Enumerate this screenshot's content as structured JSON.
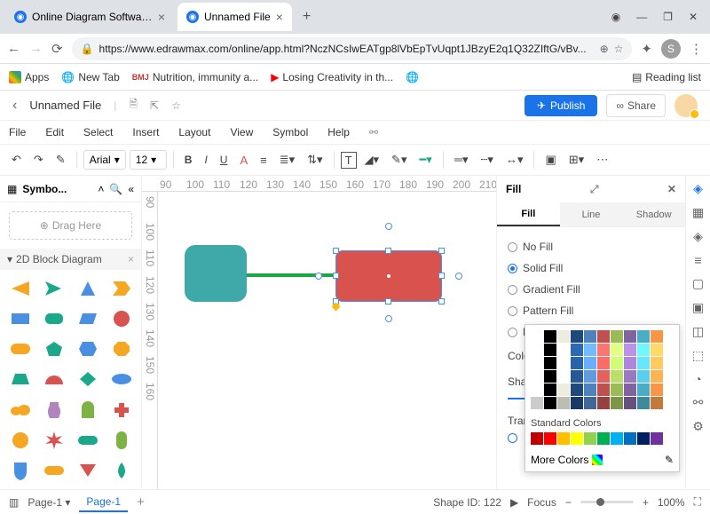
{
  "browser": {
    "tabs": [
      {
        "title": "Online Diagram Software - EdrawM"
      },
      {
        "title": "Unnamed File"
      }
    ],
    "url": "https://www.edrawmax.com/online/app.html?NczNCsIwEATgp8lVbEpTvUqpt1JBzyE2q1Q32ZIftG/vBv...",
    "avatar_letter": "S"
  },
  "bookmarks": {
    "apps": "Apps",
    "newtab": "New Tab",
    "bmj": "Nutrition, immunity a...",
    "yt": "Losing Creativity in th...",
    "reading": "Reading list"
  },
  "doc": {
    "back": "‹",
    "name": "Unnamed File",
    "publish": "Publish",
    "share": "Share"
  },
  "menu": {
    "file": "File",
    "edit": "Edit",
    "select": "Select",
    "insert": "Insert",
    "layout": "Layout",
    "view": "View",
    "symbol": "Symbol",
    "help": "Help"
  },
  "toolbar": {
    "font": "Arial",
    "size": "12"
  },
  "left": {
    "title": "Symbo...",
    "drag": "Drag Here",
    "section": "2D Block Diagram"
  },
  "ruler_h": [
    "90",
    "100",
    "110",
    "120",
    "130",
    "140",
    "150",
    "160",
    "170",
    "180",
    "190",
    "200",
    "210"
  ],
  "ruler_v": [
    "90",
    "100",
    "110",
    "120",
    "130",
    "140",
    "150",
    "160"
  ],
  "right": {
    "title": "Fill",
    "tabs": {
      "fill": "Fill",
      "line": "Line",
      "shadow": "Shadow"
    },
    "opts": {
      "nofill": "No Fill",
      "solid": "Solid Fill",
      "gradient": "Gradient Fill",
      "pattern": "Pattern Fill",
      "picture": "Picture Fill"
    },
    "color_label": "Color:",
    "shade_label": "Shade/T",
    "transp_label": "Transpa"
  },
  "popup": {
    "standard": "Standard Colors",
    "more": "More Colors"
  },
  "status": {
    "page_sel": "Page-1",
    "page_tab": "Page-1",
    "shape": "Shape ID: 122",
    "focus": "Focus",
    "zoom": "100%"
  }
}
